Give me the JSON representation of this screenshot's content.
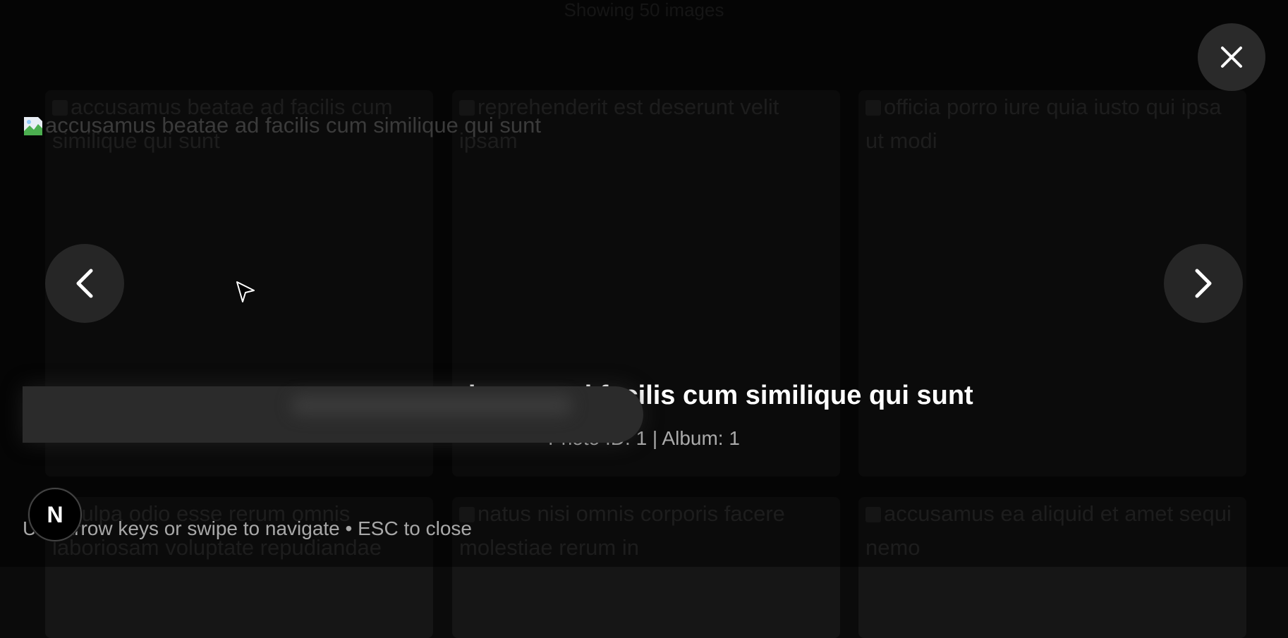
{
  "gallery": {
    "count_text": "Showing 50 images",
    "cards": [
      {
        "caption": "accusamus beatae ad facilis cum similique qui sunt"
      },
      {
        "caption": "reprehenderit est deserunt velit ipsam"
      },
      {
        "caption": "officia porro iure quia iusto qui ipsa ut modi"
      },
      {
        "caption": "culpa odio esse rerum omnis laboriosam voluptate repudiandae"
      },
      {
        "caption": "natus nisi omnis corporis facere molestiae rerum in"
      },
      {
        "caption": "accusamus ea aliquid et amet sequi nemo"
      }
    ]
  },
  "lightbox": {
    "image_alt": "accusamus beatae ad facilis cum similique qui sunt",
    "title": "accusamus beatae ad facilis cum similique qui sunt",
    "meta": "Photo ID: 1 | Album: 1",
    "hint": "Use arrow keys or swipe to navigate • ESC to close",
    "close_icon": "close-icon",
    "prev_icon": "chevron-left-icon",
    "next_icon": "chevron-right-icon"
  },
  "dev_badge": {
    "letter": "N"
  }
}
